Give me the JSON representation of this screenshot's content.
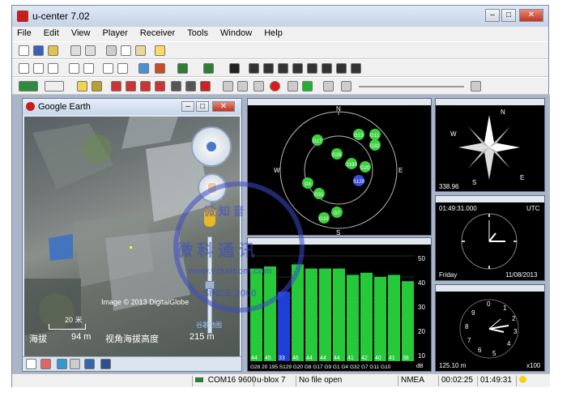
{
  "app": {
    "title": "u-center 7.02"
  },
  "menu": [
    "File",
    "Edit",
    "View",
    "Player",
    "Receiver",
    "Tools",
    "Window",
    "Help"
  ],
  "google_earth": {
    "title": "Google Earth",
    "image_credit": "Image © 2013 DigitalGlobe",
    "scale_label": "20 米",
    "elevation_label": "海拔",
    "elevation_value": "94 m",
    "eye_label": "视角海拔高度",
    "eye_value": "215 m",
    "brand": "谷歌地图"
  },
  "sky_view": {
    "compass": [
      "N",
      "E",
      "S",
      "W"
    ],
    "satellites": [
      {
        "id": "G13",
        "color": "green"
      },
      {
        "id": "G11",
        "color": "green"
      },
      {
        "id": "G17",
        "color": "green"
      },
      {
        "id": "G32",
        "color": "green"
      },
      {
        "id": "G28",
        "color": "green"
      },
      {
        "id": "Q193",
        "color": "green"
      },
      {
        "id": "G20",
        "color": "green"
      },
      {
        "id": "G4",
        "color": "green"
      },
      {
        "id": "S129",
        "color": "blue"
      },
      {
        "id": "G31",
        "color": "green"
      },
      {
        "id": "G7",
        "color": "green"
      },
      {
        "id": "G10",
        "color": "green"
      }
    ]
  },
  "signal_chart": {
    "yticks": [
      "50",
      "40",
      "30",
      "20",
      "10",
      "dB"
    ],
    "values": [
      "44",
      "45",
      "33",
      "46",
      "44",
      "44",
      "44",
      "41",
      "42",
      "40",
      "41",
      "38"
    ],
    "bars_db": [
      44,
      45,
      33,
      46,
      44,
      44,
      44,
      41,
      42,
      40,
      41,
      38
    ],
    "labels": [
      "G28",
      "G20",
      "195",
      "S129",
      "G20",
      "G8",
      "G17",
      "G9",
      "G1",
      "G4",
      "G32",
      "G7",
      "G11",
      "G10"
    ]
  },
  "compass_pane": {
    "letters": [
      "N",
      "E",
      "S",
      "W"
    ],
    "heading": "338.96"
  },
  "clock_pane": {
    "time": "01:49:31.000",
    "zone": "UTC",
    "day": "Friday",
    "date": "11/08/2013"
  },
  "altimeter_pane": {
    "altitude": "125.10 m",
    "scale": "x100"
  },
  "status": {
    "port": "COM16 9600",
    "receiver": "u-blox 7",
    "file": "No file open",
    "protocol": "NMEA",
    "elapsed": "00:02:25",
    "utc": "01:49:31"
  },
  "watermark": {
    "line1": "微 知 音",
    "line2": "微 科 通 讯",
    "url": "www.vzkelcom.com",
    "since": "SINCE 2000"
  },
  "colors": {
    "bar_green": "#26c93a",
    "bar_blue": "#1f3fd6",
    "sat_green": "#3ecf3e",
    "sat_blue": "#3a4de0"
  }
}
